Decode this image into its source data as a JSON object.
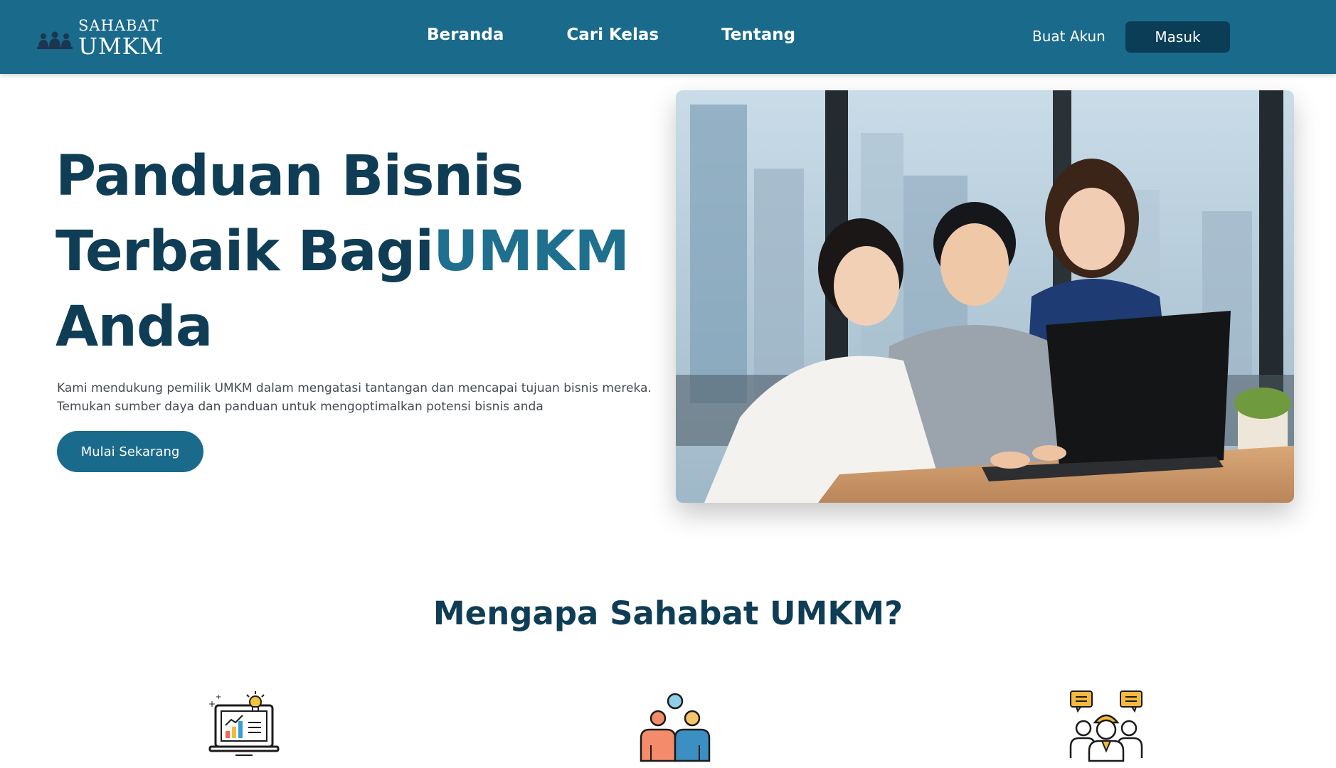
{
  "header": {
    "logo_small": "SAHABAT",
    "logo_big": "UMKM",
    "nav": [
      {
        "label": "Beranda"
      },
      {
        "label": "Cari Kelas"
      },
      {
        "label": "Tentang"
      }
    ],
    "signup_label": "Buat Akun",
    "login_label": "Masuk"
  },
  "hero": {
    "title_part1": "Panduan Bisnis Terbaik Bagi",
    "title_accent": "UMKM",
    "title_part2": "Anda",
    "description_line1": "Kami mendukung pemilik UMKM dalam mengatasi tantangan dan mencapai tujuan bisnis mereka.",
    "description_line2": "Temukan sumber daya dan panduan untuk mengoptimalkan potensi bisnis anda",
    "cta_label": "Mulai Sekarang",
    "image_subject": "three-colleagues-working-on-laptop-photo"
  },
  "why": {
    "title": "Mengapa Sahabat UMKM?",
    "features": [
      {
        "icon": "laptop-chart-lightbulb-icon"
      },
      {
        "icon": "community-people-icon"
      },
      {
        "icon": "consultation-people-chat-icon"
      }
    ]
  },
  "colors": {
    "primary": "#1a6a8b",
    "dark_navy": "#0b3d56",
    "heading": "#0f3d55",
    "accent_text": "#1f6f8f"
  }
}
